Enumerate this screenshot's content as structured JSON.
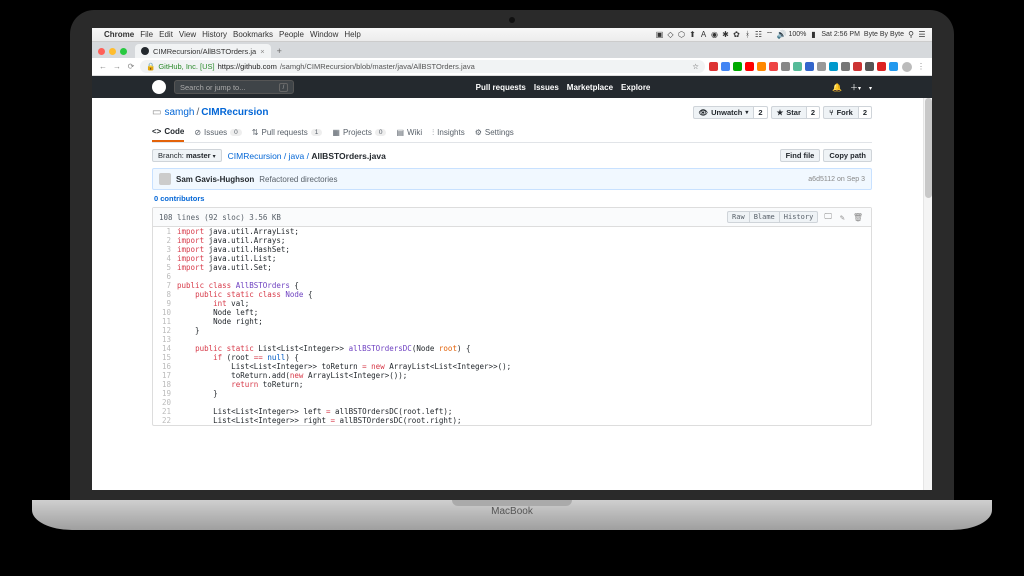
{
  "macos": {
    "app": "Chrome",
    "menus": [
      "File",
      "Edit",
      "View",
      "History",
      "Bookmarks",
      "People",
      "Window",
      "Help"
    ],
    "battery": "100%",
    "clock": "Sat 2:56 PM",
    "username": "Byte By Byte"
  },
  "browser": {
    "tab_title": "CIMRecursion/AllBSTOrders.ja",
    "url_prefix": "GitHub, Inc. [US]",
    "url_host": "https://github.com",
    "url_path": "/samgh/CIMRecursion/blob/master/java/AllBSTOrders.java"
  },
  "github": {
    "search_placeholder": "Search or jump to...",
    "nav": [
      "Pull requests",
      "Issues",
      "Marketplace",
      "Explore"
    ],
    "owner": "samgh",
    "repo": "CIMRecursion",
    "actions": {
      "watch": {
        "label": "Unwatch",
        "count": "2"
      },
      "star": {
        "label": "Star",
        "count": "2"
      },
      "fork": {
        "label": "Fork",
        "count": "2"
      }
    },
    "tabs": [
      {
        "label": "Code",
        "active": true
      },
      {
        "label": "Issues",
        "badge": "0"
      },
      {
        "label": "Pull requests",
        "badge": "1"
      },
      {
        "label": "Projects",
        "badge": "0"
      },
      {
        "label": "Wiki"
      },
      {
        "label": "Insights"
      },
      {
        "label": "Settings"
      }
    ],
    "branch_label": "Branch:",
    "branch": "master",
    "crumbs": [
      "CIMRecursion",
      "java",
      "AllBSTOrders.java"
    ],
    "crumb_actions": [
      "Find file",
      "Copy path"
    ],
    "commit": {
      "author": "Sam Gavis-Hughson",
      "message": "Refactored directories",
      "hash": "a6d5112",
      "date": "on Sep 3"
    },
    "contributors": "0 contributors",
    "file_meta": "108 lines (92 sloc)  3.56 KB",
    "file_actions": [
      "Raw",
      "Blame",
      "History"
    ],
    "code": [
      {
        "n": "1",
        "html": "<span class='kw-import'>import</span> java.util.ArrayList;"
      },
      {
        "n": "2",
        "html": "<span class='kw-import'>import</span> java.util.Arrays;"
      },
      {
        "n": "3",
        "html": "<span class='kw-import'>import</span> java.util.HashSet;"
      },
      {
        "n": "4",
        "html": "<span class='kw-import'>import</span> java.util.List;"
      },
      {
        "n": "5",
        "html": "<span class='kw-import'>import</span> java.util.Set;"
      },
      {
        "n": "6",
        "html": ""
      },
      {
        "n": "7",
        "html": "<span class='kw'>public class</span> <span class='cls'>AllBSTOrders</span> {"
      },
      {
        "n": "8",
        "html": "    <span class='kw'>public static class</span> <span class='cls'>Node</span> {"
      },
      {
        "n": "9",
        "html": "        <span class='kw'>int</span> val;"
      },
      {
        "n": "10",
        "html": "        Node left;"
      },
      {
        "n": "11",
        "html": "        Node right;"
      },
      {
        "n": "12",
        "html": "    }"
      },
      {
        "n": "13",
        "html": ""
      },
      {
        "n": "14",
        "html": "    <span class='kw'>public static</span> List&lt;List&lt;Integer&gt;&gt; <span class='cls'>allBSTOrdersDC</span>(Node <span class='param'>root</span>) {"
      },
      {
        "n": "15",
        "html": "        <span class='kw'>if</span> (root <span class='kw'>==</span> <span class='type'>null</span>) {"
      },
      {
        "n": "16",
        "html": "            List&lt;List&lt;Integer&gt;&gt; toReturn <span class='kw'>=</span> <span class='kw'>new</span> ArrayList&lt;List&lt;Integer&gt;&gt;();"
      },
      {
        "n": "17",
        "html": "            toReturn.add(<span class='kw'>new</span> ArrayList&lt;Integer&gt;());"
      },
      {
        "n": "18",
        "html": "            <span class='kw'>return</span> toReturn;"
      },
      {
        "n": "19",
        "html": "        }"
      },
      {
        "n": "20",
        "html": ""
      },
      {
        "n": "21",
        "html": "        List&lt;List&lt;Integer&gt;&gt; left <span class='kw'>=</span> allBSTOrdersDC(root.left);"
      },
      {
        "n": "22",
        "html": "        List&lt;List&lt;Integer&gt;&gt; right <span class='kw'>=</span> allBSTOrdersDC(root.right);"
      }
    ]
  },
  "laptop": {
    "brand": "MacBook"
  }
}
